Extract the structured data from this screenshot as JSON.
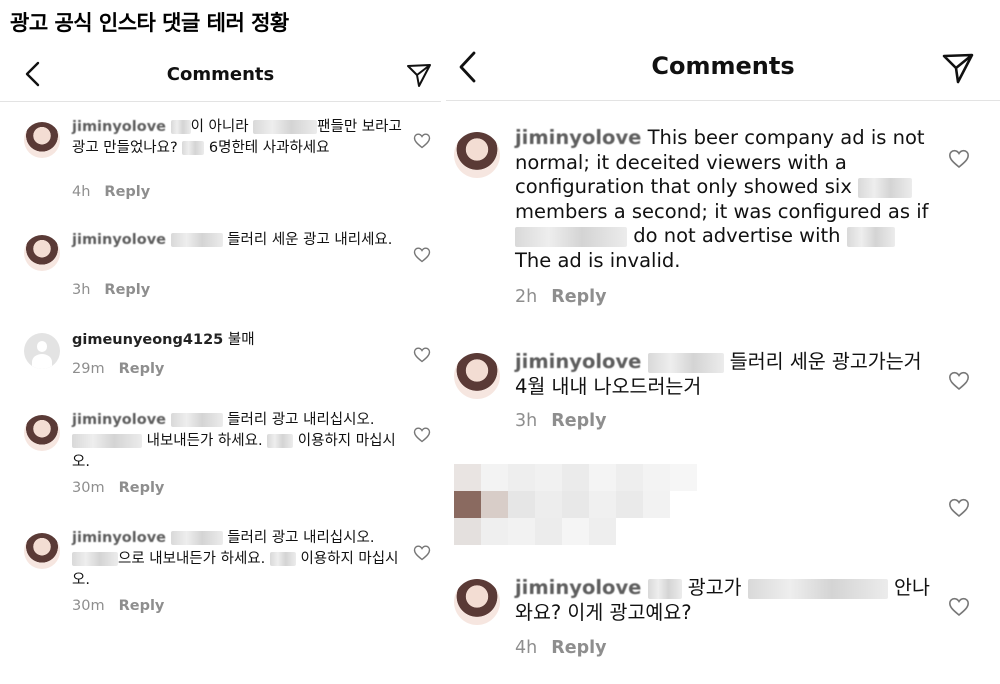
{
  "caption": "광고 공식 인스타 댓글 테러 정황",
  "left": {
    "header": {
      "title": "Comments",
      "back_icon": "chevron-left-icon",
      "send_icon": "send-icon"
    },
    "comments": [
      {
        "user": "jiminyolove",
        "text_a": "이 아니라",
        "text_b": "팬들만 보라고 광고 만들었나요?",
        "text_c": "6명한테 사과하세요",
        "time": "4h",
        "reply": "Reply"
      },
      {
        "user": "jiminyolove",
        "text_a": "들러리 세운 광고 내리세요.",
        "time": "3h",
        "reply": "Reply"
      },
      {
        "user": "gimeunyeong4125",
        "text_a": "불매",
        "time": "29m",
        "reply": "Reply"
      },
      {
        "user": "jiminyolove",
        "text_a": "들러리 광고 내리십시오.",
        "text_b": "내보내든가 하세요.",
        "text_c": "이용하지 마십시오.",
        "time": "30m",
        "reply": "Reply"
      },
      {
        "user": "jiminyolove",
        "text_a": "들러리 광고 내리십시오.",
        "text_b": "으로 내보내든가 하세요.",
        "text_c": "이용하지 마십시오.",
        "time": "30m",
        "reply": "Reply"
      }
    ]
  },
  "right": {
    "header": {
      "title": "Comments",
      "back_icon": "chevron-left-icon",
      "send_icon": "send-icon"
    },
    "comments": [
      {
        "user": "jiminyolove",
        "text_a": "This beer company ad is not normal; it deceited viewers with a configuration that only showed six",
        "text_b": "members a second; it was configured as if",
        "text_c": "do not advertise with",
        "text_d": "The ad is invalid.",
        "time": "2h",
        "reply": "Reply"
      },
      {
        "user": "jiminyolove",
        "text_a": "들러리 세운 광고가는거",
        "text_b": "4월 내내 나오드러는거",
        "time": "3h",
        "reply": "Reply"
      },
      {
        "user": "jiminyolove",
        "text_a": "광고가",
        "text_b": "안나",
        "text_c": "와요? 이게 광고예요?",
        "time": "4h",
        "reply": "Reply"
      }
    ]
  },
  "colors": {
    "meta_gray": "#8e8e8e",
    "blur_gray": "#dcdcdc",
    "divider": "#e3e3e3"
  }
}
